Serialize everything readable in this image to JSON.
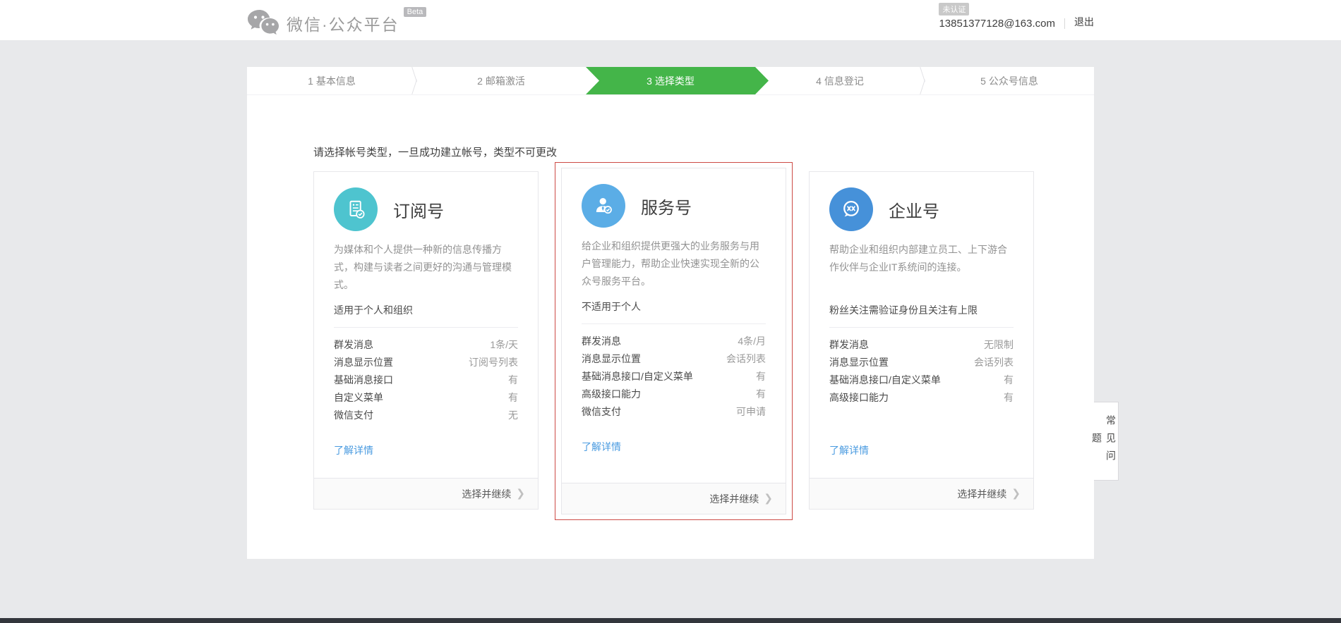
{
  "header": {
    "logo_text": "微信·公众平台",
    "beta_label": "Beta",
    "account": {
      "status_badge": "未认证",
      "email": "13851377128@163.com",
      "logout_label": "退出"
    }
  },
  "wizard": {
    "active_step": 3,
    "steps": [
      {
        "label": "1 基本信息"
      },
      {
        "label": "2 邮箱激活"
      },
      {
        "label": "3 选择类型"
      },
      {
        "label": "4 信息登记"
      },
      {
        "label": "5 公众号信息"
      }
    ]
  },
  "notice": "请选择帐号类型，一旦成功建立帐号，类型不可更改",
  "cards": [
    {
      "title": "订阅号",
      "icon": "document-check-icon",
      "icon_color": "#4ec4cf",
      "description": "为媒体和个人提供一种新的信息传播方式，构建与读者之间更好的沟通与管理模式。",
      "audience": "适用于个人和组织",
      "features": [
        {
          "label": "群发消息",
          "value": "1条/天"
        },
        {
          "label": "消息显示位置",
          "value": "订阅号列表"
        },
        {
          "label": "基础消息接口",
          "value": "有"
        },
        {
          "label": "自定义菜单",
          "value": "有"
        },
        {
          "label": "微信支付",
          "value": "无"
        }
      ],
      "details_link": "了解详情",
      "action_label": "选择并继续",
      "highlighted": false
    },
    {
      "title": "服务号",
      "icon": "person-check-icon",
      "icon_color": "#5bade6",
      "description": "给企业和组织提供更强大的业务服务与用户管理能力，帮助企业快速实现全新的公众号服务平台。",
      "audience": "不适用于个人",
      "features": [
        {
          "label": "群发消息",
          "value": "4条/月"
        },
        {
          "label": "消息显示位置",
          "value": "会话列表"
        },
        {
          "label": "基础消息接口/自定义菜单",
          "value": "有"
        },
        {
          "label": "高级接口能力",
          "value": "有"
        },
        {
          "label": "微信支付",
          "value": "可申请"
        }
      ],
      "details_link": "了解详情",
      "action_label": "选择并继续",
      "highlighted": true
    },
    {
      "title": "企业号",
      "icon": "chat-link-icon",
      "icon_color": "#4691d9",
      "description": "帮助企业和组织内部建立员工、上下游合作伙伴与企业IT系统间的连接。",
      "audience": "粉丝关注需验证身份且关注有上限",
      "features": [
        {
          "label": "群发消息",
          "value": "无限制"
        },
        {
          "label": "消息显示位置",
          "value": "会话列表"
        },
        {
          "label": "基础消息接口/自定义菜单",
          "value": "有"
        },
        {
          "label": "高级接口能力",
          "value": "有"
        }
      ],
      "details_link": "了解详情",
      "action_label": "选择并继续",
      "highlighted": false
    }
  ],
  "faq_tab": "常见问题",
  "icons": {
    "action_chevron": "❯"
  },
  "colors": {
    "accent_green": "#44b549",
    "highlight_red": "#cd4a45",
    "link_blue": "#4a9be0",
    "subscription_teal": "#4ec4cf",
    "service_blue": "#5bade6",
    "enterprise_blue": "#4691d9"
  }
}
